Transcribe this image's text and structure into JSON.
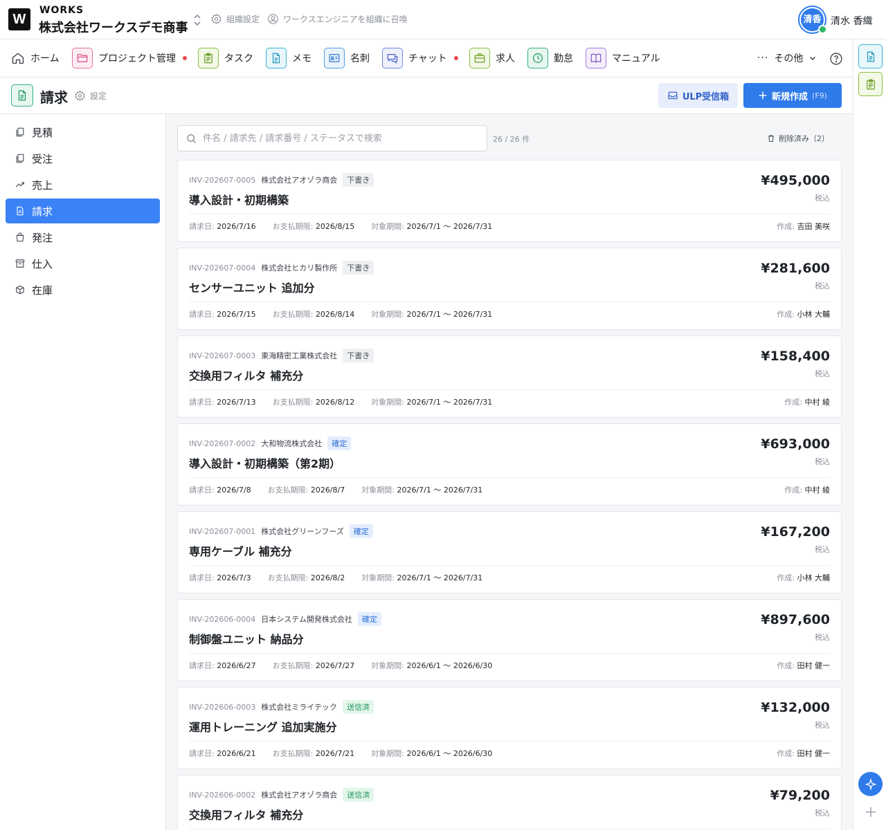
{
  "app": {
    "logo_letter": "W",
    "brand": "WORKS",
    "org_name": "株式会社ワークスデモ商事",
    "org_settings": "組織設定",
    "invite": "ワークスエンジニアを組織に召喚",
    "user_initials": "清香",
    "user_name": "清水 香織"
  },
  "nav": {
    "items": [
      {
        "label": "ホーム"
      },
      {
        "label": "プロジェクト管理"
      },
      {
        "label": "タスク"
      },
      {
        "label": "メモ"
      },
      {
        "label": "名刺"
      },
      {
        "label": "チャット"
      },
      {
        "label": "求人"
      },
      {
        "label": "勤怠"
      },
      {
        "label": "マニュアル"
      }
    ],
    "more": "その他"
  },
  "page": {
    "title": "請求",
    "settings": "設定",
    "inbox_btn": "ULP受信箱",
    "new_btn": "新規作成",
    "new_hint": "(F9)"
  },
  "sidebar": {
    "items": [
      {
        "label": "見積"
      },
      {
        "label": "受注"
      },
      {
        "label": "売上"
      },
      {
        "label": "請求"
      },
      {
        "label": "発注"
      },
      {
        "label": "仕入"
      },
      {
        "label": "在庫"
      }
    ]
  },
  "search": {
    "placeholder": "件名 / 請求先 / 請求番号 / ステータスで検索",
    "count": "26 / 26 件",
    "deleted": "削除済み（2）"
  },
  "labels": {
    "invoice_date": "請求日:",
    "due_date": "お支払期限:",
    "period": "対象期間:",
    "author": "作成:",
    "tax": "税込"
  },
  "invoices": [
    {
      "no": "INV-202607-0005",
      "client": "株式会社アオゾラ商会",
      "status": "下書き",
      "title": "導入設計・初期構築",
      "amount": "¥495,000",
      "date": "2026/7/16",
      "due": "2026/8/15",
      "period": "2026/7/1 〜 2026/7/31",
      "author": "吉田 美咲"
    },
    {
      "no": "INV-202607-0004",
      "client": "株式会社ヒカリ製作所",
      "status": "下書き",
      "title": "センサーユニット 追加分",
      "amount": "¥281,600",
      "date": "2026/7/15",
      "due": "2026/8/14",
      "period": "2026/7/1 〜 2026/7/31",
      "author": "小林 大輔"
    },
    {
      "no": "INV-202607-0003",
      "client": "東海精密工業株式会社",
      "status": "下書き",
      "title": "交換用フィルタ 補充分",
      "amount": "¥158,400",
      "date": "2026/7/13",
      "due": "2026/8/12",
      "period": "2026/7/1 〜 2026/7/31",
      "author": "中村 綾"
    },
    {
      "no": "INV-202607-0002",
      "client": "大和物流株式会社",
      "status": "確定",
      "title": "導入設計・初期構築（第2期）",
      "amount": "¥693,000",
      "date": "2026/7/8",
      "due": "2026/8/7",
      "period": "2026/7/1 〜 2026/7/31",
      "author": "中村 綾"
    },
    {
      "no": "INV-202607-0001",
      "client": "株式会社グリーンフーズ",
      "status": "確定",
      "title": "専用ケーブル 補充分",
      "amount": "¥167,200",
      "date": "2026/7/3",
      "due": "2026/8/2",
      "period": "2026/7/1 〜 2026/7/31",
      "author": "小林 大輔"
    },
    {
      "no": "INV-202606-0004",
      "client": "日本システム開発株式会社",
      "status": "確定",
      "title": "制御盤ユニット 納品分",
      "amount": "¥897,600",
      "date": "2026/6/27",
      "due": "2026/7/27",
      "period": "2026/6/1 〜 2026/6/30",
      "author": "田村 健一"
    },
    {
      "no": "INV-202606-0003",
      "client": "株式会社ミライテック",
      "status": "送信済",
      "title": "運用トレーニング 追加実施分",
      "amount": "¥132,000",
      "date": "2026/6/21",
      "due": "2026/7/21",
      "period": "2026/6/1 〜 2026/6/30",
      "author": "田村 健一"
    },
    {
      "no": "INV-202606-0002",
      "client": "株式会社アオゾラ商会",
      "status": "送信済",
      "title": "交換用フィルタ 補充分",
      "amount": "¥79,200",
      "date": "",
      "due": "",
      "period": "",
      "author": ""
    }
  ],
  "colors": {
    "accent": "#2f7bea",
    "status_draft_bg": "#eef0f3",
    "status_draft_fg": "#4a4f57",
    "status_fixed_bg": "#e3edfd",
    "status_fixed_fg": "#2f6fd6",
    "status_sent_bg": "#e2f6ea",
    "status_sent_fg": "#23945a"
  }
}
